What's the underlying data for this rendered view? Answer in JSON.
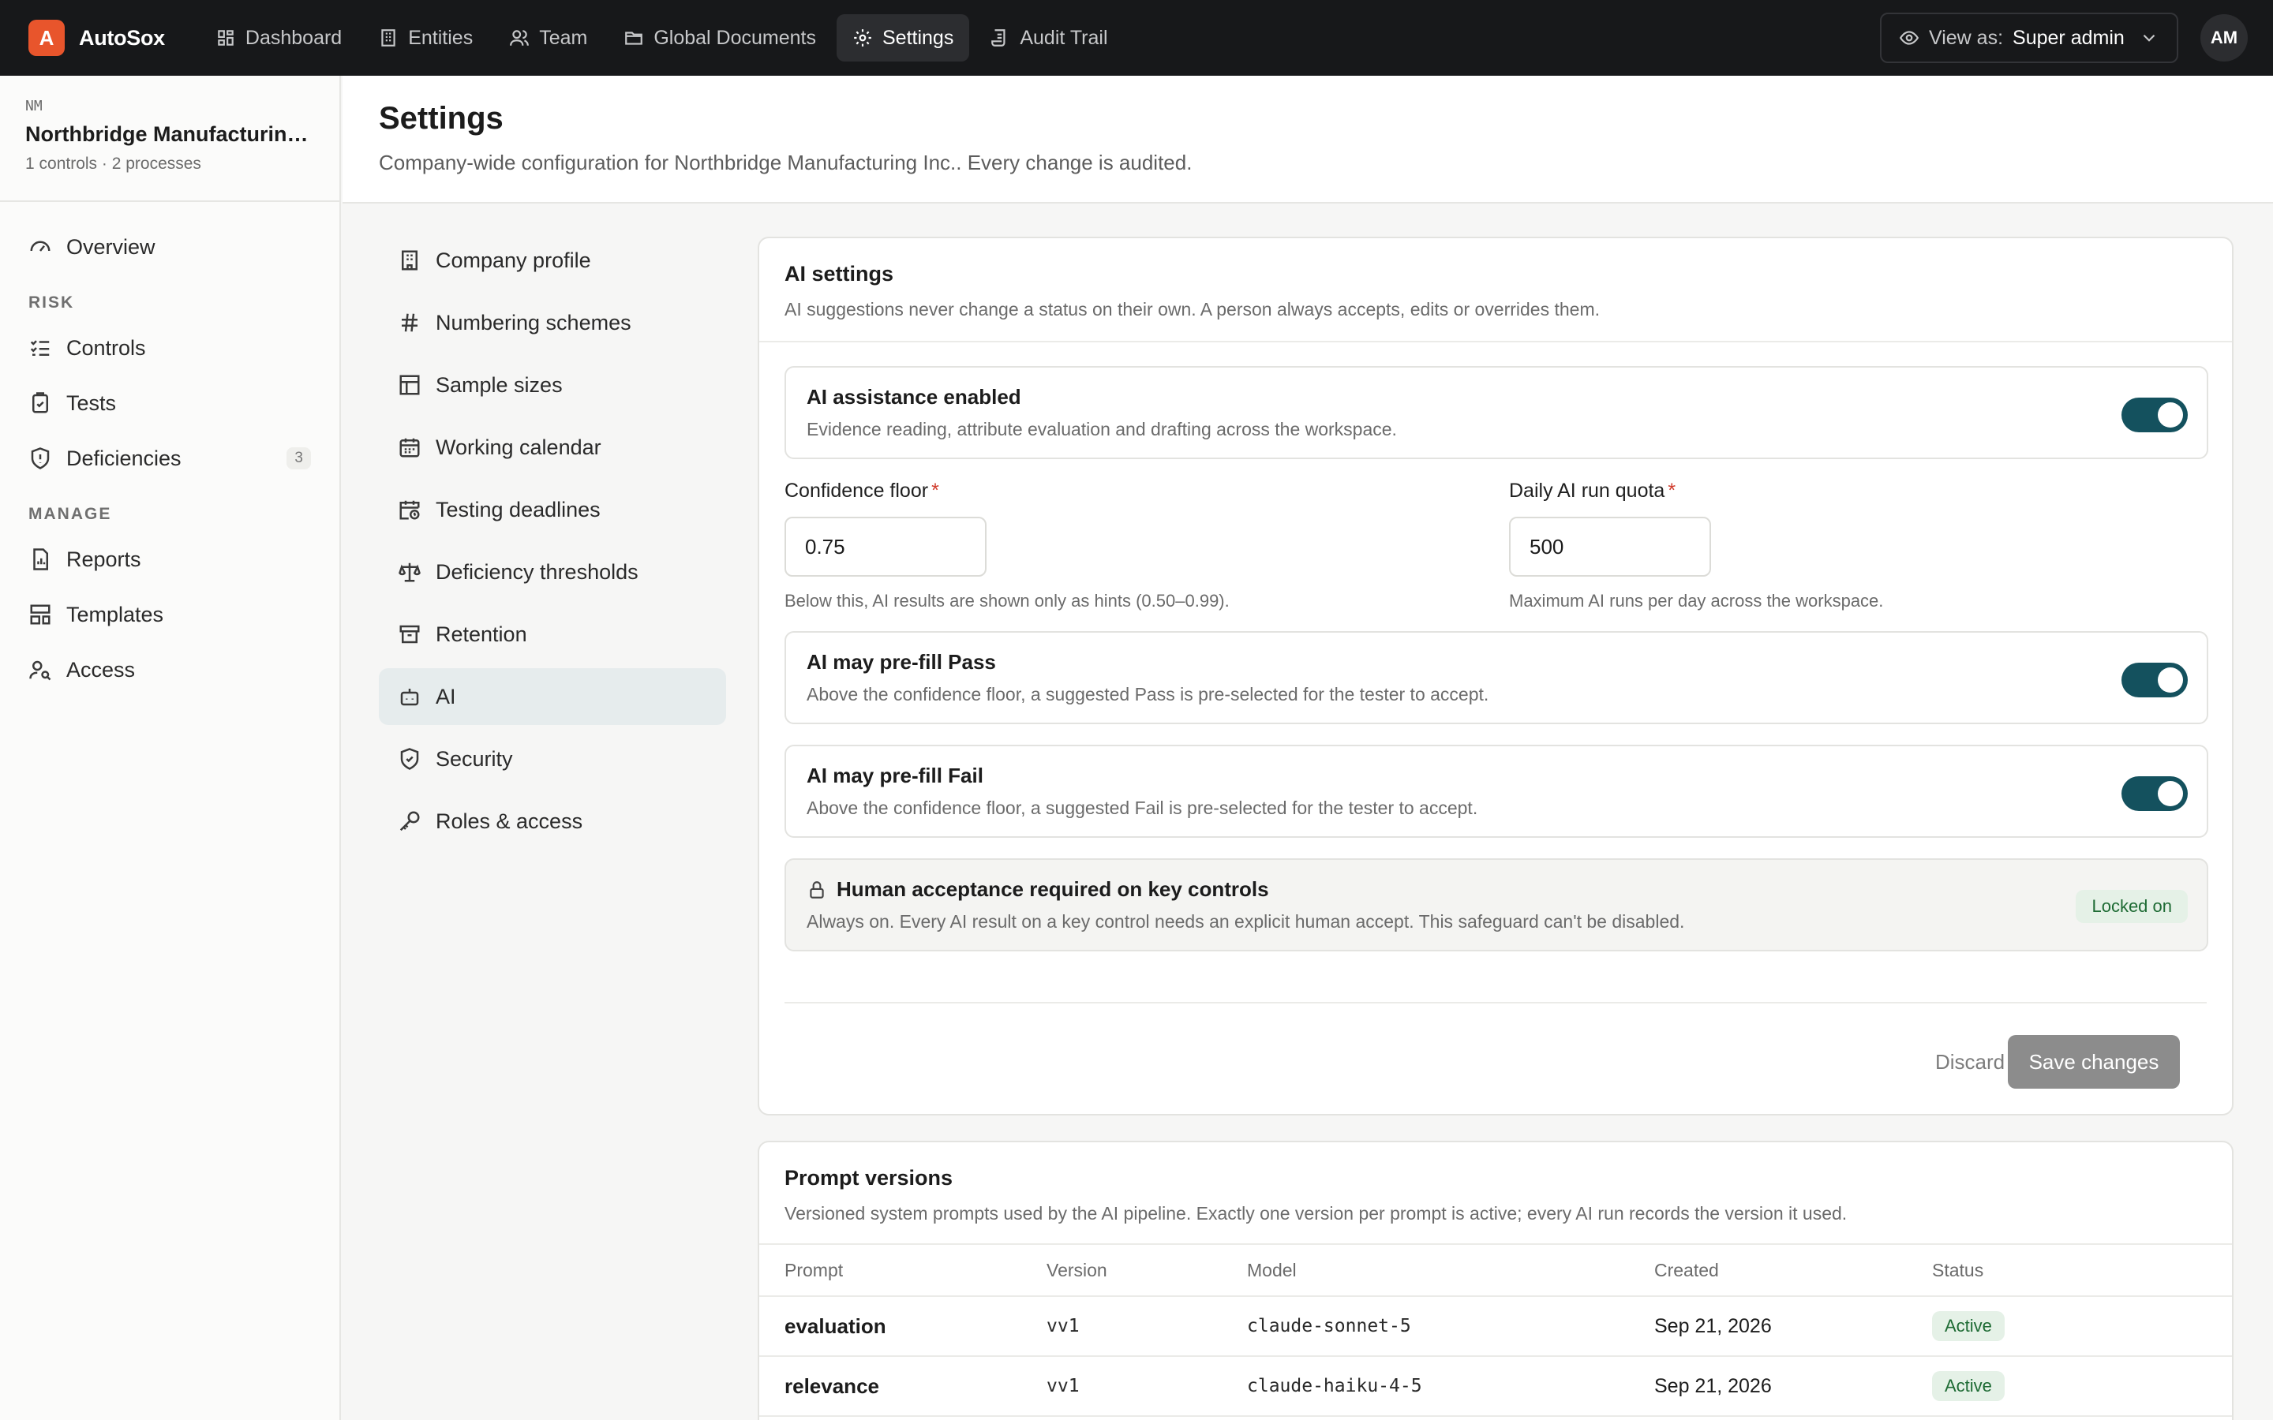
{
  "app": {
    "logo_letter": "A",
    "name": "AutoSox"
  },
  "nav": [
    {
      "label": "Dashboard",
      "icon": "grid-icon"
    },
    {
      "label": "Entities",
      "icon": "building-icon"
    },
    {
      "label": "Team",
      "icon": "users-icon"
    },
    {
      "label": "Global Documents",
      "icon": "folder-icon"
    },
    {
      "label": "Settings",
      "icon": "gear-icon",
      "active": true
    },
    {
      "label": "Audit Trail",
      "icon": "scroll-icon"
    }
  ],
  "view_as": {
    "label": "View as:",
    "role": "Super admin"
  },
  "user": {
    "initials": "AM"
  },
  "entity": {
    "code": "NM",
    "name": "Northbridge Manufacturing Inc.",
    "meta": "1 controls · 2 processes"
  },
  "sidebar": {
    "overview": "Overview",
    "risk_section": "RISK",
    "controls": "Controls",
    "tests": "Tests",
    "deficiencies": "Deficiencies",
    "deficiencies_count": "3",
    "manage_section": "MANAGE",
    "reports": "Reports",
    "templates": "Templates",
    "access": "Access"
  },
  "page": {
    "title": "Settings",
    "subtitle": "Company-wide configuration for Northbridge Manufacturing Inc.. Every change is audited."
  },
  "settings_nav": [
    "Company profile",
    "Numbering schemes",
    "Sample sizes",
    "Working calendar",
    "Testing deadlines",
    "Deficiency thresholds",
    "Retention",
    "AI",
    "Security",
    "Roles & access"
  ],
  "ai_settings": {
    "title": "AI settings",
    "description": "AI suggestions never change a status on their own. A person always accepts, edits or overrides them.",
    "assistance": {
      "title": "AI assistance enabled",
      "description": "Evidence reading, attribute evaluation and drafting across the workspace.",
      "enabled": true
    },
    "confidence_floor": {
      "label": "Confidence floor",
      "value": "0.75",
      "help": "Below this, AI results are shown only as hints (0.50–0.99)."
    },
    "daily_quota": {
      "label": "Daily AI run quota",
      "value": "500",
      "help": "Maximum AI runs per day across the workspace."
    },
    "prefill_pass": {
      "title": "AI may pre-fill Pass",
      "description": "Above the confidence floor, a suggested Pass is pre-selected for the tester to accept.",
      "enabled": true
    },
    "prefill_fail": {
      "title": "AI may pre-fill Fail",
      "description": "Above the confidence floor, a suggested Fail is pre-selected for the tester to accept.",
      "enabled": true
    },
    "human_acceptance": {
      "title": "Human acceptance required on key controls",
      "description": "Always on. Every AI result on a key control needs an explicit human accept. This safeguard can't be disabled.",
      "badge": "Locked on"
    },
    "discard_label": "Discard",
    "save_label": "Save changes"
  },
  "prompt_versions": {
    "title": "Prompt versions",
    "description": "Versioned system prompts used by the AI pipeline. Exactly one version per prompt is active; every AI run records the version it used.",
    "columns": [
      "Prompt",
      "Version",
      "Model",
      "Created",
      "Status"
    ],
    "rows": [
      {
        "prompt": "evaluation",
        "version": "vv1",
        "model": "claude-sonnet-5",
        "created": "Sep 21, 2026",
        "status": "Active"
      },
      {
        "prompt": "relevance",
        "version": "vv1",
        "model": "claude-haiku-4-5",
        "created": "Sep 21, 2026",
        "status": "Active"
      }
    ]
  },
  "colors": {
    "accent": "#14515e",
    "brand": "#e8552c",
    "topbar": "#17181a",
    "success_bg": "#e5f1e7",
    "success_text": "#1e6b34"
  }
}
